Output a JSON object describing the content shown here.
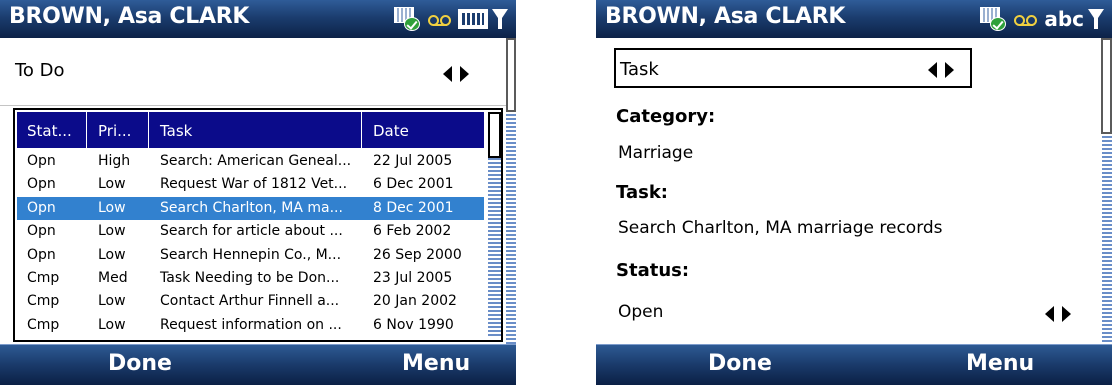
{
  "left_screen": {
    "title": "BROWN, Asa CLARK",
    "view": {
      "label": "To Do"
    },
    "columns": [
      "Stat...",
      "Pri...",
      "Task",
      "Date"
    ],
    "rows": [
      {
        "status": "Opn",
        "priority": "High",
        "task": "Search: American Geneal...",
        "date": "22 Jul 2005"
      },
      {
        "status": "Opn",
        "priority": "Low",
        "task": "Request War of 1812 Vet...",
        "date": "6 Dec 2001"
      },
      {
        "status": "Opn",
        "priority": "Low",
        "task": "Search Charlton, MA ma...",
        "date": "8 Dec 2001",
        "selected": true
      },
      {
        "status": "Opn",
        "priority": "Low",
        "task": "Search for article about ...",
        "date": "6 Feb 2002"
      },
      {
        "status": "Opn",
        "priority": "Low",
        "task": "Search Hennepin Co., M...",
        "date": "26 Sep 2000"
      },
      {
        "status": "Cmp",
        "priority": "Med",
        "task": "Task Needing to be Don...",
        "date": "23 Jul 2005"
      },
      {
        "status": "Cmp",
        "priority": "Low",
        "task": "Contact Arthur Finnell a...",
        "date": "20 Jan 2002"
      },
      {
        "status": "Cmp",
        "priority": "Low",
        "task": "Request information on ...",
        "date": "6 Nov 1990"
      }
    ],
    "softkeys": {
      "left": "Done",
      "right": "Menu"
    }
  },
  "right_screen": {
    "title": "BROWN, Asa CLARK",
    "input_mode": "abc",
    "selector": {
      "label": "Task"
    },
    "fields": [
      {
        "label": "Category:",
        "value": "Marriage"
      },
      {
        "label": "Task:",
        "value": "Search Charlton, MA marriage records"
      },
      {
        "label": "Status:",
        "value": "Open"
      }
    ],
    "softkeys": {
      "left": "Done",
      "right": "Menu"
    }
  },
  "status_icons": [
    "data-connection-icon",
    "voicemail-icon",
    "battery-icon",
    "signal-icon"
  ],
  "colors": {
    "titlebar": "#1b3d6f",
    "header_row": "#0b0b8a",
    "selected_row": "#3281cf",
    "voicemail_icon": "#f0d040",
    "sync_check": "#2fa03a"
  }
}
